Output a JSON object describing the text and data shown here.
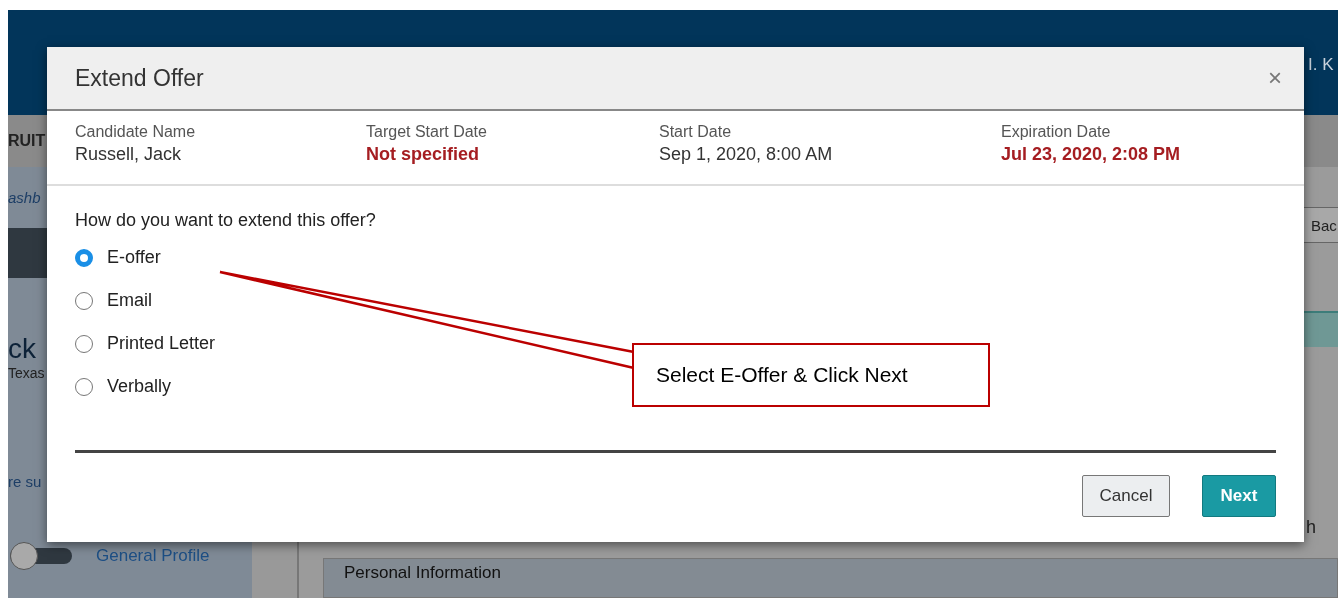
{
  "background": {
    "header_user": "I. K",
    "nav_tab": "RUIT",
    "breadcrumb": "ashb",
    "candidate_name": "ck",
    "candidate_location": "Texas",
    "link": "re su",
    "toggle": {
      "label": "General Profile",
      "on": false
    },
    "back_button": "Bac",
    "fragment": "h",
    "section_title": "Personal Information"
  },
  "modal": {
    "title": "Extend Offer",
    "close": "×",
    "fields": [
      {
        "label": "Candidate Name",
        "value": "Russell, Jack",
        "highlight": false
      },
      {
        "label": "Target Start Date",
        "value": "Not specified",
        "highlight": true
      },
      {
        "label": "Start Date",
        "value": "Sep 1, 2020, 8:00 AM",
        "highlight": false
      },
      {
        "label": "Expiration Date",
        "value": "Jul 23, 2020, 2:08 PM",
        "highlight": true
      }
    ],
    "question": "How do you want to extend this offer?",
    "options": [
      {
        "label": "E-offer",
        "selected": true
      },
      {
        "label": "Email",
        "selected": false
      },
      {
        "label": "Printed Letter",
        "selected": false
      },
      {
        "label": "Verbally",
        "selected": false
      }
    ],
    "buttons": [
      {
        "label": "Cancel",
        "kind": "secondary"
      },
      {
        "label": "Next",
        "kind": "primary"
      }
    ]
  },
  "annotation": {
    "text": "Select E-Offer & Click Next"
  }
}
